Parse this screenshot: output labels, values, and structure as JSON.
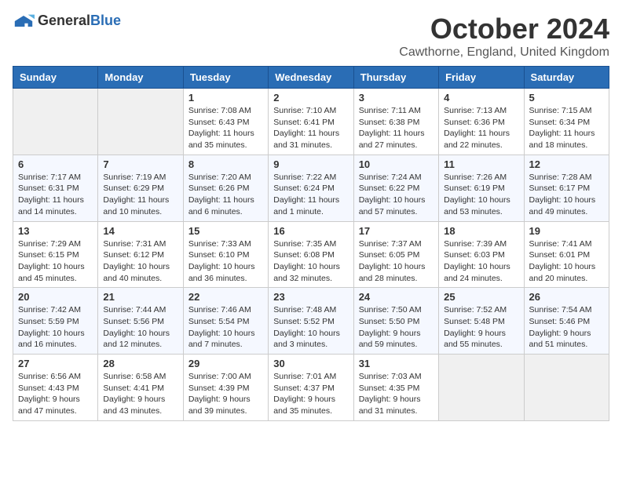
{
  "logo": {
    "general": "General",
    "blue": "Blue"
  },
  "title": "October 2024",
  "location": "Cawthorne, England, United Kingdom",
  "headers": [
    "Sunday",
    "Monday",
    "Tuesday",
    "Wednesday",
    "Thursday",
    "Friday",
    "Saturday"
  ],
  "weeks": [
    [
      {
        "day": "",
        "sunrise": "",
        "sunset": "",
        "daylight": ""
      },
      {
        "day": "",
        "sunrise": "",
        "sunset": "",
        "daylight": ""
      },
      {
        "day": "1",
        "sunrise": "Sunrise: 7:08 AM",
        "sunset": "Sunset: 6:43 PM",
        "daylight": "Daylight: 11 hours and 35 minutes."
      },
      {
        "day": "2",
        "sunrise": "Sunrise: 7:10 AM",
        "sunset": "Sunset: 6:41 PM",
        "daylight": "Daylight: 11 hours and 31 minutes."
      },
      {
        "day": "3",
        "sunrise": "Sunrise: 7:11 AM",
        "sunset": "Sunset: 6:38 PM",
        "daylight": "Daylight: 11 hours and 27 minutes."
      },
      {
        "day": "4",
        "sunrise": "Sunrise: 7:13 AM",
        "sunset": "Sunset: 6:36 PM",
        "daylight": "Daylight: 11 hours and 22 minutes."
      },
      {
        "day": "5",
        "sunrise": "Sunrise: 7:15 AM",
        "sunset": "Sunset: 6:34 PM",
        "daylight": "Daylight: 11 hours and 18 minutes."
      }
    ],
    [
      {
        "day": "6",
        "sunrise": "Sunrise: 7:17 AM",
        "sunset": "Sunset: 6:31 PM",
        "daylight": "Daylight: 11 hours and 14 minutes."
      },
      {
        "day": "7",
        "sunrise": "Sunrise: 7:19 AM",
        "sunset": "Sunset: 6:29 PM",
        "daylight": "Daylight: 11 hours and 10 minutes."
      },
      {
        "day": "8",
        "sunrise": "Sunrise: 7:20 AM",
        "sunset": "Sunset: 6:26 PM",
        "daylight": "Daylight: 11 hours and 6 minutes."
      },
      {
        "day": "9",
        "sunrise": "Sunrise: 7:22 AM",
        "sunset": "Sunset: 6:24 PM",
        "daylight": "Daylight: 11 hours and 1 minute."
      },
      {
        "day": "10",
        "sunrise": "Sunrise: 7:24 AM",
        "sunset": "Sunset: 6:22 PM",
        "daylight": "Daylight: 10 hours and 57 minutes."
      },
      {
        "day": "11",
        "sunrise": "Sunrise: 7:26 AM",
        "sunset": "Sunset: 6:19 PM",
        "daylight": "Daylight: 10 hours and 53 minutes."
      },
      {
        "day": "12",
        "sunrise": "Sunrise: 7:28 AM",
        "sunset": "Sunset: 6:17 PM",
        "daylight": "Daylight: 10 hours and 49 minutes."
      }
    ],
    [
      {
        "day": "13",
        "sunrise": "Sunrise: 7:29 AM",
        "sunset": "Sunset: 6:15 PM",
        "daylight": "Daylight: 10 hours and 45 minutes."
      },
      {
        "day": "14",
        "sunrise": "Sunrise: 7:31 AM",
        "sunset": "Sunset: 6:12 PM",
        "daylight": "Daylight: 10 hours and 40 minutes."
      },
      {
        "day": "15",
        "sunrise": "Sunrise: 7:33 AM",
        "sunset": "Sunset: 6:10 PM",
        "daylight": "Daylight: 10 hours and 36 minutes."
      },
      {
        "day": "16",
        "sunrise": "Sunrise: 7:35 AM",
        "sunset": "Sunset: 6:08 PM",
        "daylight": "Daylight: 10 hours and 32 minutes."
      },
      {
        "day": "17",
        "sunrise": "Sunrise: 7:37 AM",
        "sunset": "Sunset: 6:05 PM",
        "daylight": "Daylight: 10 hours and 28 minutes."
      },
      {
        "day": "18",
        "sunrise": "Sunrise: 7:39 AM",
        "sunset": "Sunset: 6:03 PM",
        "daylight": "Daylight: 10 hours and 24 minutes."
      },
      {
        "day": "19",
        "sunrise": "Sunrise: 7:41 AM",
        "sunset": "Sunset: 6:01 PM",
        "daylight": "Daylight: 10 hours and 20 minutes."
      }
    ],
    [
      {
        "day": "20",
        "sunrise": "Sunrise: 7:42 AM",
        "sunset": "Sunset: 5:59 PM",
        "daylight": "Daylight: 10 hours and 16 minutes."
      },
      {
        "day": "21",
        "sunrise": "Sunrise: 7:44 AM",
        "sunset": "Sunset: 5:56 PM",
        "daylight": "Daylight: 10 hours and 12 minutes."
      },
      {
        "day": "22",
        "sunrise": "Sunrise: 7:46 AM",
        "sunset": "Sunset: 5:54 PM",
        "daylight": "Daylight: 10 hours and 7 minutes."
      },
      {
        "day": "23",
        "sunrise": "Sunrise: 7:48 AM",
        "sunset": "Sunset: 5:52 PM",
        "daylight": "Daylight: 10 hours and 3 minutes."
      },
      {
        "day": "24",
        "sunrise": "Sunrise: 7:50 AM",
        "sunset": "Sunset: 5:50 PM",
        "daylight": "Daylight: 9 hours and 59 minutes."
      },
      {
        "day": "25",
        "sunrise": "Sunrise: 7:52 AM",
        "sunset": "Sunset: 5:48 PM",
        "daylight": "Daylight: 9 hours and 55 minutes."
      },
      {
        "day": "26",
        "sunrise": "Sunrise: 7:54 AM",
        "sunset": "Sunset: 5:46 PM",
        "daylight": "Daylight: 9 hours and 51 minutes."
      }
    ],
    [
      {
        "day": "27",
        "sunrise": "Sunrise: 6:56 AM",
        "sunset": "Sunset: 4:43 PM",
        "daylight": "Daylight: 9 hours and 47 minutes."
      },
      {
        "day": "28",
        "sunrise": "Sunrise: 6:58 AM",
        "sunset": "Sunset: 4:41 PM",
        "daylight": "Daylight: 9 hours and 43 minutes."
      },
      {
        "day": "29",
        "sunrise": "Sunrise: 7:00 AM",
        "sunset": "Sunset: 4:39 PM",
        "daylight": "Daylight: 9 hours and 39 minutes."
      },
      {
        "day": "30",
        "sunrise": "Sunrise: 7:01 AM",
        "sunset": "Sunset: 4:37 PM",
        "daylight": "Daylight: 9 hours and 35 minutes."
      },
      {
        "day": "31",
        "sunrise": "Sunrise: 7:03 AM",
        "sunset": "Sunset: 4:35 PM",
        "daylight": "Daylight: 9 hours and 31 minutes."
      },
      {
        "day": "",
        "sunrise": "",
        "sunset": "",
        "daylight": ""
      },
      {
        "day": "",
        "sunrise": "",
        "sunset": "",
        "daylight": ""
      }
    ]
  ]
}
